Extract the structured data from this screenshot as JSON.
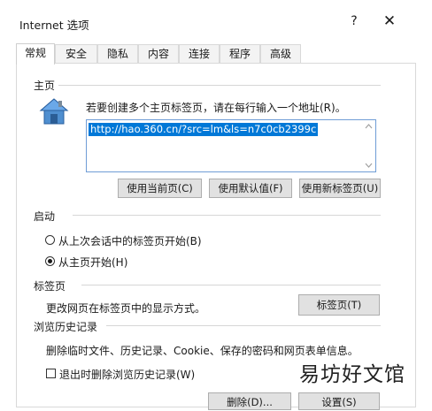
{
  "window": {
    "title": "Internet 选项",
    "help": "?",
    "close": "✕"
  },
  "tabs": [
    {
      "label": "常规"
    },
    {
      "label": "安全"
    },
    {
      "label": "隐私"
    },
    {
      "label": "内容"
    },
    {
      "label": "连接"
    },
    {
      "label": "程序"
    },
    {
      "label": "高级"
    }
  ],
  "home": {
    "group_title": "主页",
    "instruction": "若要创建多个主页标签页，请在每行输入一个地址(R)。",
    "url": "http://hao.360.cn/?src=lm&ls=n7c0cb2399c",
    "btn_current": "使用当前页(C)",
    "btn_default": "使用默认值(F)",
    "btn_newtab": "使用新标签页(U)"
  },
  "startup": {
    "group_title": "启动",
    "option_last": "从上次会话中的标签页开始(B)",
    "option_home": "从主页开始(H)",
    "selected": "option_home"
  },
  "tabs_group": {
    "group_title": "标签页",
    "description": "更改网页在标签页中的显示方式。",
    "btn": "标签页(T)"
  },
  "history": {
    "group_title": "浏览历史记录",
    "description": "删除临时文件、历史记录、Cookie、保存的密码和网页表单信息。",
    "checkbox_label": "退出时删除浏览历史记录(W)",
    "btn_delete": "删除(D)...",
    "btn_settings": "设置(S)"
  },
  "watermark": "易坊好文馆",
  "colors": {
    "selection": "#0078d7",
    "focus_border": "#6f9dd6",
    "button_face": "#e1e1e1"
  }
}
